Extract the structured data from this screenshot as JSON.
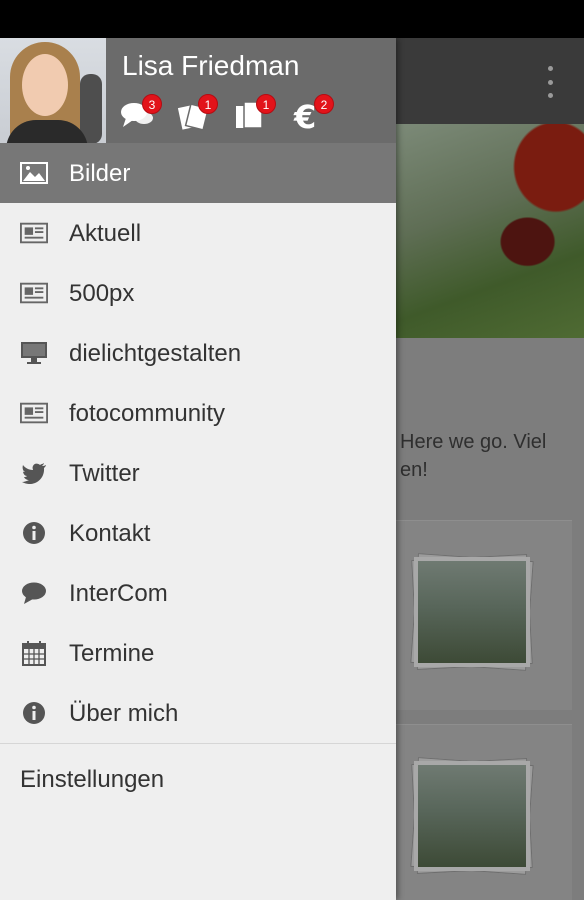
{
  "user": {
    "name": "Lisa Friedman"
  },
  "notifications": [
    {
      "icon": "chat-icon",
      "count": "3"
    },
    {
      "icon": "tickets-icon",
      "count": "1"
    },
    {
      "icon": "documents-icon",
      "count": "1"
    },
    {
      "icon": "euro-icon",
      "count": "2"
    }
  ],
  "menu": {
    "items": [
      {
        "label": "Bilder",
        "icon": "image-icon",
        "active": true
      },
      {
        "label": "Aktuell",
        "icon": "newspaper-icon"
      },
      {
        "label": "500px",
        "icon": "newspaper-icon"
      },
      {
        "label": "dielichtgestalten",
        "icon": "monitor-icon"
      },
      {
        "label": "fotocommunity",
        "icon": "newspaper-icon"
      },
      {
        "label": "Twitter",
        "icon": "twitter-icon"
      },
      {
        "label": "Kontakt",
        "icon": "info-icon"
      },
      {
        "label": "InterCom",
        "icon": "chat-bubble-icon"
      },
      {
        "label": "Termine",
        "icon": "calendar-icon"
      },
      {
        "label": "Über mich",
        "icon": "info-icon"
      }
    ],
    "settings_label": "Einstellungen"
  },
  "background": {
    "text": "Here we go. Viel\nen!"
  },
  "colors": {
    "drawer_bg": "#efefef",
    "header_bg": "#6b6b6b",
    "active_item_bg": "#777777",
    "badge": "#e2131a"
  }
}
